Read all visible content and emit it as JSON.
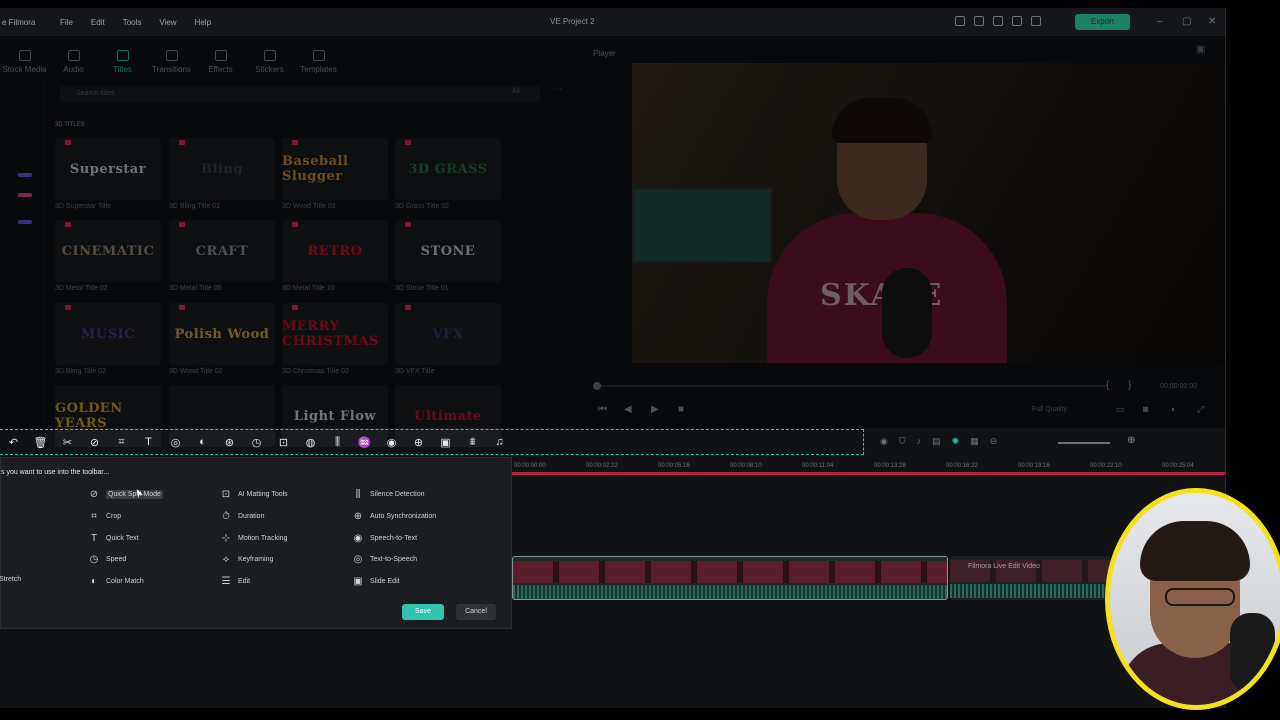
{
  "titlebar": {
    "brand": "e Filmora",
    "menu": [
      "File",
      "Edit",
      "Tools",
      "View",
      "Help"
    ],
    "project_title": "VE Project 2",
    "export_label": "Export"
  },
  "tabs": [
    {
      "label": "Stock Media",
      "icon": "stock-media-icon"
    },
    {
      "label": "Audio",
      "icon": "music-icon"
    },
    {
      "label": "Titles",
      "icon": "titles-icon",
      "active": true
    },
    {
      "label": "Transitions",
      "icon": "transitions-icon"
    },
    {
      "label": "Effects",
      "icon": "effects-icon"
    },
    {
      "label": "Stickers",
      "icon": "stickers-icon"
    },
    {
      "label": "Templates",
      "icon": "templates-icon"
    }
  ],
  "library": {
    "search_placeholder": "Search titles",
    "filter_label": "All",
    "section": "3D TITLES",
    "items": [
      {
        "thumb": "Superstar",
        "caption": "3D Superstar Title",
        "color": "#c9d2e0"
      },
      {
        "thumb": "Bling",
        "caption": "3D Bling Title 01",
        "color": "#3a3f45"
      },
      {
        "thumb": "Baseball Slugger",
        "caption": "3D Wood Title 03",
        "color": "#c78a3a"
      },
      {
        "thumb": "3D GRASS",
        "caption": "3D Grass Title 02",
        "color": "#2f6b3e"
      },
      {
        "thumb": "CINEMATIC",
        "caption": "3D Metal Title 02",
        "color": "#9a8a78"
      },
      {
        "thumb": "CRAFT",
        "caption": "3D Metal Title 05",
        "color": "#8a8f95"
      },
      {
        "thumb": "RETRO",
        "caption": "3D Metal Title 10",
        "color": "#c8102e"
      },
      {
        "thumb": "STONE",
        "caption": "3D Stone Title 01",
        "color": "#c4c8cc"
      },
      {
        "thumb": "MUSIC",
        "caption": "3D Bling Title 02",
        "color": "#4b3a9a"
      },
      {
        "thumb": "Polish Wood",
        "caption": "3D Wood Title 02",
        "color": "#d4a24a"
      },
      {
        "thumb": "MERRY CHRISTMAS",
        "caption": "3D Christmas Title 02",
        "color": "#c8102e"
      },
      {
        "thumb": "VFX",
        "caption": "3D VFX Title",
        "color": "#2c3c8a"
      },
      {
        "thumb": "GOLDEN YEARS",
        "caption": "",
        "color": "#c9a227"
      },
      {
        "thumb": "",
        "caption": "",
        "color": "#c8102e"
      },
      {
        "thumb": "Light Flow",
        "caption": "",
        "color": "#d0d4d8"
      },
      {
        "thumb": "Ultimate",
        "caption": "",
        "color": "#c8102e"
      }
    ]
  },
  "player": {
    "label": "Player",
    "time": "00:00:00:00",
    "quality": "Full Quality",
    "hoodie_text": "SKATE"
  },
  "toolbar": {
    "tools": [
      "↶",
      "🗑",
      "✂",
      "⊘",
      "⌗",
      "T",
      "◎",
      "◐",
      "⊛",
      "◷",
      "⊡",
      "◍",
      "⫼",
      "♒",
      "◉",
      "⊕",
      "▣",
      "⩩",
      "♫"
    ]
  },
  "timeline": {
    "ticks": [
      "00:00:00:00",
      "00:00:02:22",
      "00:00:05:16",
      "00:00:08:10",
      "00:00:11:04",
      "00:00:13:28",
      "00:00:16:22",
      "00:00:19:16",
      "00:00:22:10",
      "00:00:25:04"
    ],
    "clip2_label": "Filmora Live Edit Video"
  },
  "dialog": {
    "title": "s you want to use into the toolbar...",
    "options": [
      {
        "label": "Stretch",
        "icon": "stretch-icon",
        "glyph": ""
      },
      {
        "label": "Quick Split Mode",
        "icon": "split-icon",
        "glyph": "⊘"
      },
      {
        "label": "Crop",
        "icon": "crop-icon",
        "glyph": "⌗"
      },
      {
        "label": "Quick Text",
        "icon": "text-icon",
        "glyph": "T"
      },
      {
        "label": "Speed",
        "icon": "speed-icon",
        "glyph": "◷"
      },
      {
        "label": "Color Match",
        "icon": "color-match-icon",
        "glyph": "◐"
      },
      {
        "label": "AI Matting Tools",
        "icon": "ai-matting-icon",
        "glyph": "⊡"
      },
      {
        "label": "Duration",
        "icon": "duration-icon",
        "glyph": "⏱"
      },
      {
        "label": "Motion Tracking",
        "icon": "motion-tracking-icon",
        "glyph": "⊹"
      },
      {
        "label": "Keyframing",
        "icon": "keyframe-icon",
        "glyph": "⟡"
      },
      {
        "label": "Edit",
        "icon": "edit-icon",
        "glyph": "☰"
      },
      {
        "label": "Silence Detection",
        "icon": "silence-icon",
        "glyph": "⫼"
      },
      {
        "label": "Auto Synchronization",
        "icon": "sync-icon",
        "glyph": "⊕"
      },
      {
        "label": "Speech-to-Text",
        "icon": "speech-text-icon",
        "glyph": "◉"
      },
      {
        "label": "Text-to-Speech",
        "icon": "text-speech-icon",
        "glyph": "◎"
      },
      {
        "label": "Slide Edit",
        "icon": "slide-edit-icon",
        "glyph": "▣"
      }
    ],
    "save_label": "Save",
    "cancel_label": "Cancel"
  },
  "colors": {
    "accent": "#2ec5ae",
    "highlight_border": "#f5e11b",
    "playhead": "#b3203f"
  }
}
